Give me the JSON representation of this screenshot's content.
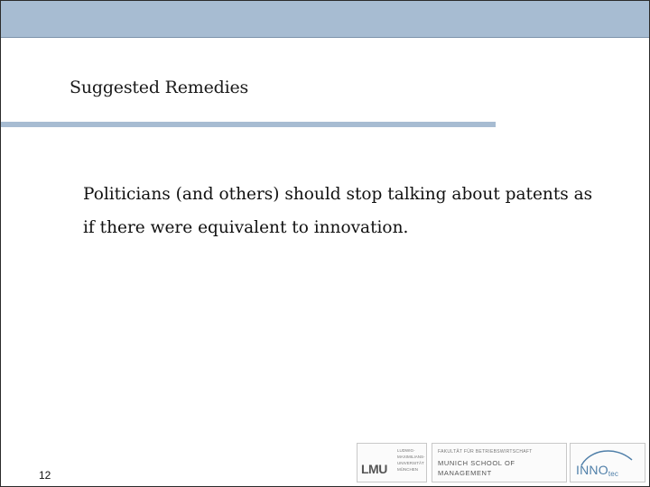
{
  "slide": {
    "title": "Suggested Remedies",
    "body_lines": [
      "Politicians (and others) should stop talking about patents as",
      "if there were equivalent to innovation."
    ],
    "page_number": "12"
  },
  "logos": {
    "lmu": {
      "mark": "LMU",
      "lines": [
        "LUDWIG-",
        "MAXIMILIANS-",
        "UNIVERSITÄT",
        "MÜNCHEN"
      ]
    },
    "msm": {
      "small": "FAKULTÄT FÜR BETRIEBSWIRTSCHAFT",
      "line1": "MUNICH SCHOOL OF",
      "line2": "MANAGEMENT"
    },
    "inno": {
      "text": "INNO",
      "suffix": "tec"
    }
  },
  "colors": {
    "band": "#a7bcd2",
    "text": "#111111",
    "inno_blue": "#4f7fa9"
  }
}
